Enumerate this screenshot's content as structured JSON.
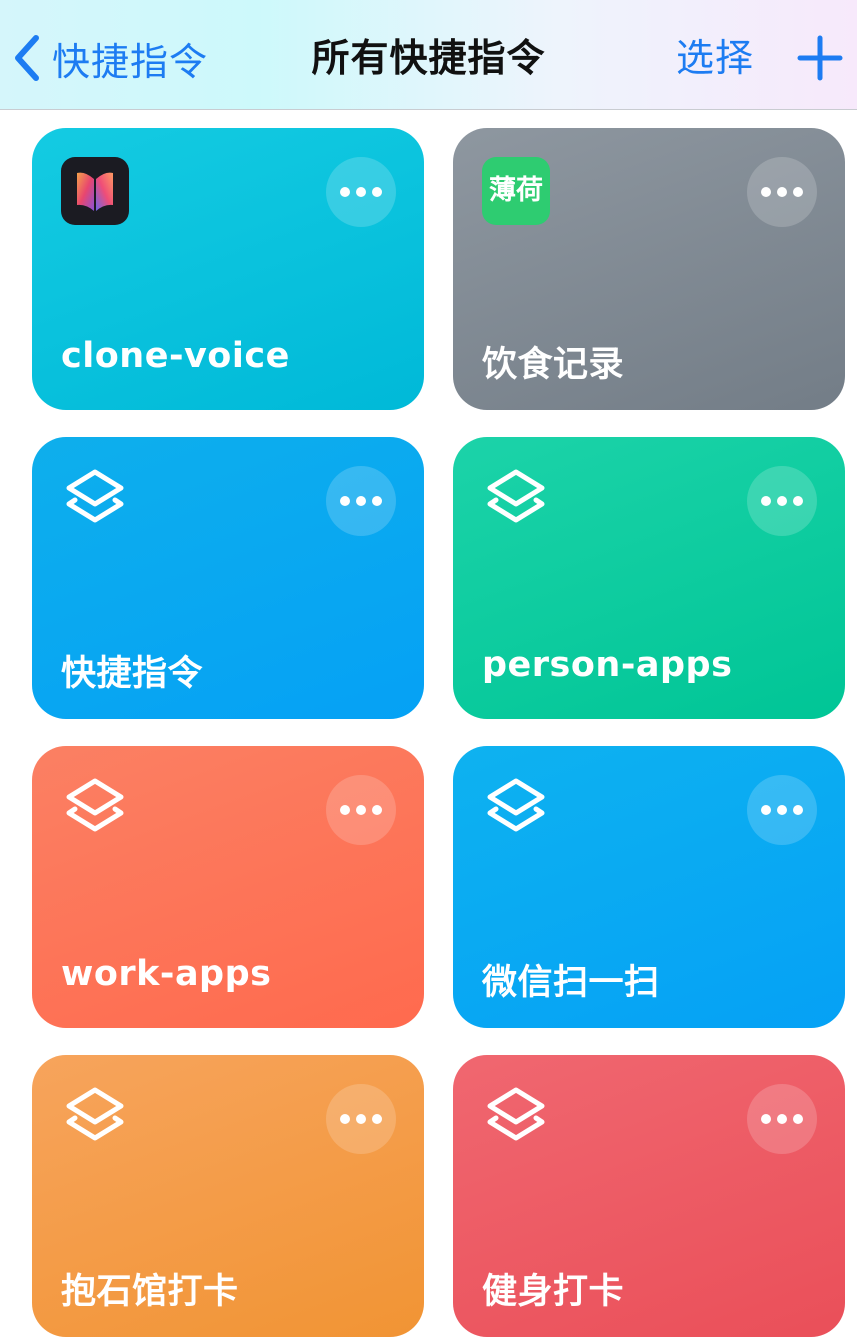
{
  "navbar": {
    "back_label": "快捷指令",
    "title": "所有快捷指令",
    "select_label": "选择"
  },
  "cards": [
    {
      "title": "clone-voice",
      "icon": "books-app-icon",
      "color_from": "#14cbe2",
      "color_to": "#00b9d8"
    },
    {
      "title": "饮食记录",
      "icon": "mint-app-icon",
      "icon_text": "薄荷",
      "color_from": "#8e97a0",
      "color_to": "#737d87"
    },
    {
      "title": "快捷指令",
      "icon": "shortcuts-stack-icon",
      "color_from": "#0eafec",
      "color_to": "#05a1f5"
    },
    {
      "title": "person-apps",
      "icon": "shortcuts-stack-icon",
      "color_from": "#1cd3a9",
      "color_to": "#00c596"
    },
    {
      "title": "work-apps",
      "icon": "shortcuts-stack-icon",
      "color_from": "#fb8063",
      "color_to": "#ff6a4e"
    },
    {
      "title": "微信扫一扫",
      "icon": "shortcuts-stack-icon",
      "color_from": "#0eb2f0",
      "color_to": "#05a1f5"
    },
    {
      "title": "抱石馆打卡",
      "icon": "shortcuts-stack-icon",
      "color_from": "#f7a45c",
      "color_to": "#f19434"
    },
    {
      "title": "健身打卡",
      "icon": "shortcuts-stack-icon",
      "color_from": "#f06770",
      "color_to": "#ea4f59"
    }
  ]
}
